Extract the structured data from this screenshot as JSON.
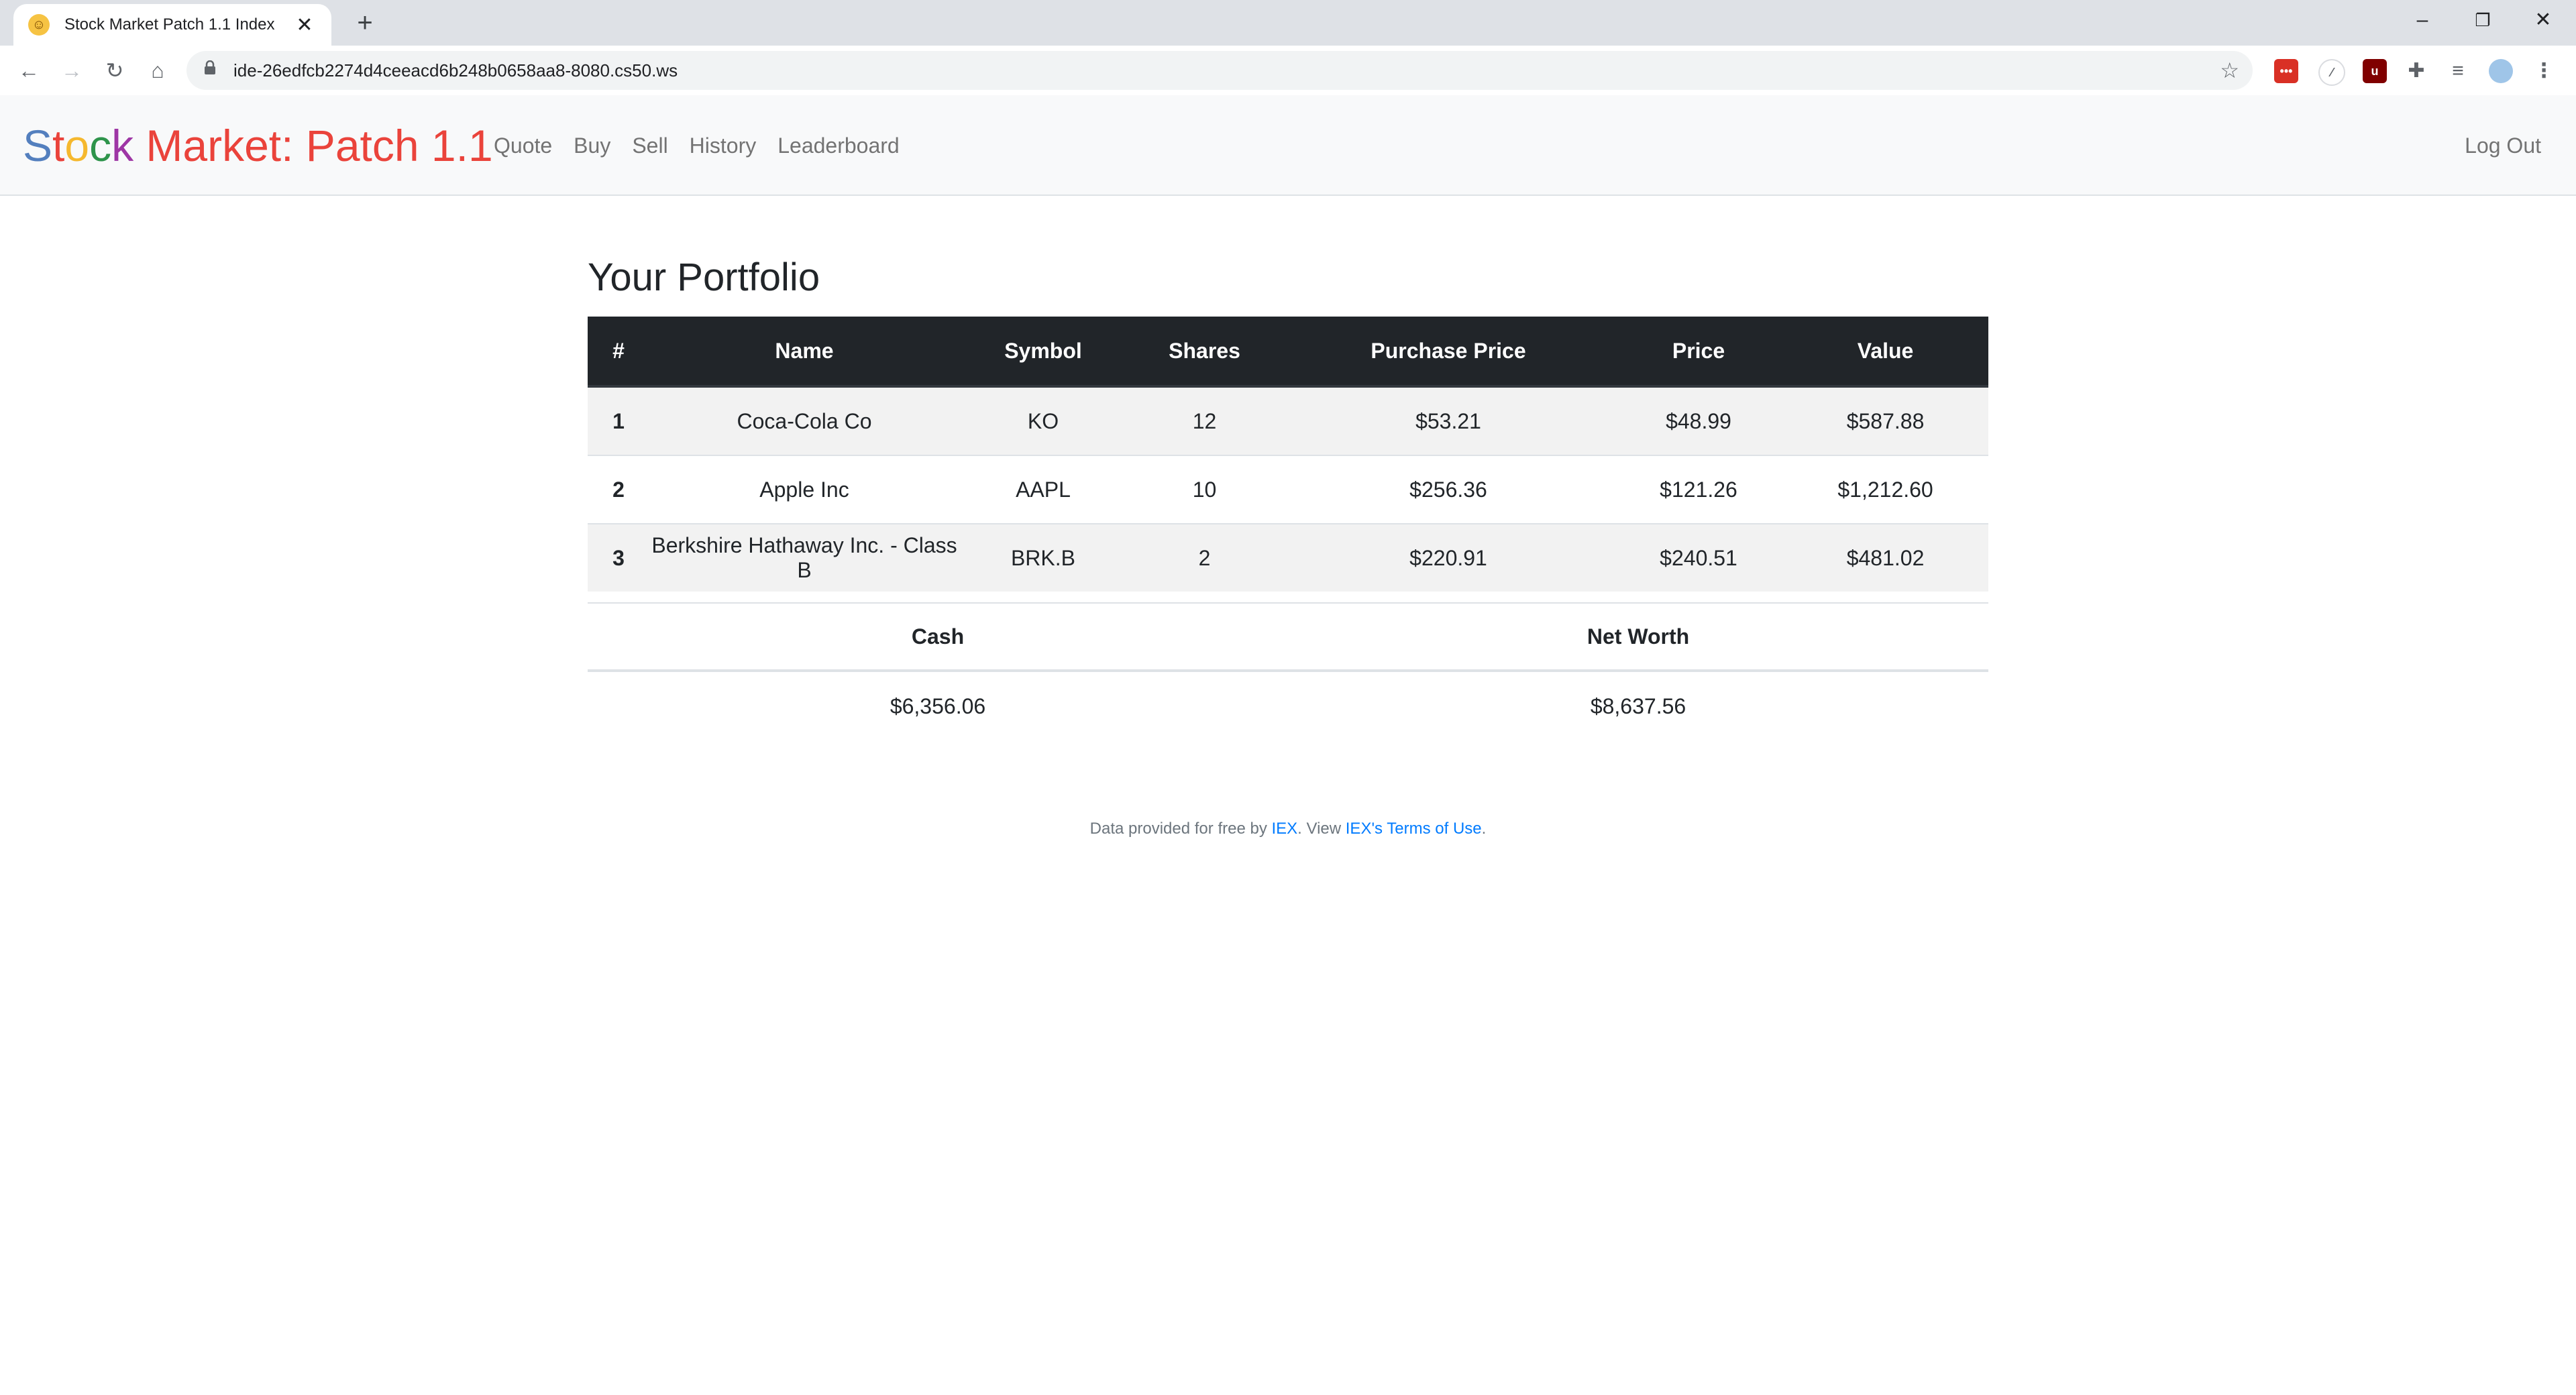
{
  "browser": {
    "tab_title": "Stock Market Patch 1.1 Index",
    "tab_close": "✕",
    "new_tab": "+",
    "url": "ide-26edfcb2274d4ceeacd6b248b0658aa8-8080.cs50.ws",
    "window_controls": {
      "minimize": "–",
      "restore": "❐",
      "close": "✕"
    },
    "nav_icons": {
      "back": "←",
      "forward": "→",
      "reload": "↻",
      "home": "⌂",
      "bookmark": "☆"
    }
  },
  "navbar": {
    "brand": {
      "letters": [
        "S",
        "t",
        "o",
        "c",
        "k"
      ],
      "rest": " Market: Patch 1.1"
    },
    "links": [
      "Quote",
      "Buy",
      "Sell",
      "History",
      "Leaderboard"
    ],
    "logout": "Log Out"
  },
  "main": {
    "title": "Your Portfolio",
    "table": {
      "headers": [
        "#",
        "Name",
        "Symbol",
        "Shares",
        "Purchase Price",
        "Price",
        "Value"
      ],
      "rows": [
        [
          "1",
          "Coca-Cola Co",
          "KO",
          "12",
          "$53.21",
          "$48.99",
          "$587.88"
        ],
        [
          "2",
          "Apple Inc",
          "AAPL",
          "10",
          "$256.36",
          "$121.26",
          "$1,212.60"
        ],
        [
          "3",
          "Berkshire Hathaway Inc. - Class B",
          "BRK.B",
          "2",
          "$220.91",
          "$240.51",
          "$481.02"
        ]
      ]
    },
    "summary": {
      "cash_label": "Cash",
      "networth_label": "Net Worth",
      "cash_value": "$6,356.06",
      "networth_value": "$8,637.56"
    }
  },
  "footer": {
    "prefix": "Data provided for free by ",
    "iex_link": "IEX",
    "middle": ". View ",
    "terms_link": "IEX's Terms of Use",
    "suffix": "."
  },
  "colors": {
    "brand_blue": "#537fbe",
    "brand_red": "#ea433b",
    "brand_yellow": "#f5b82e",
    "brand_green": "#2e944b",
    "brand_purple": "#9e36a5",
    "table_header": "#212529",
    "link": "#007bff"
  }
}
